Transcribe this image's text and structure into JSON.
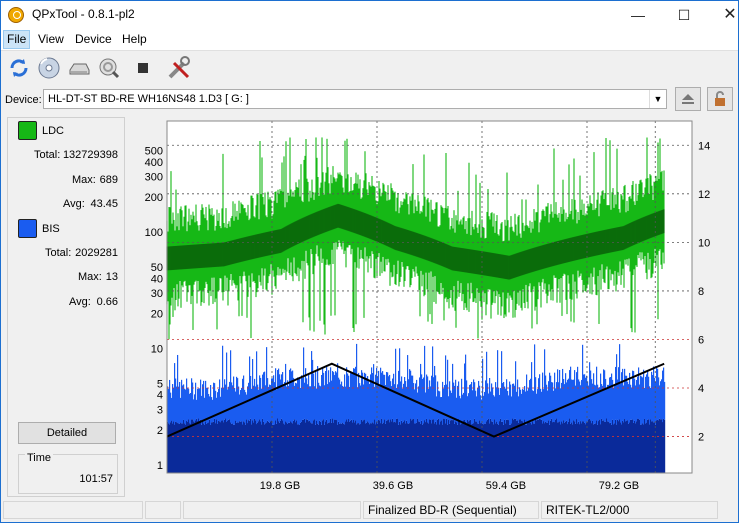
{
  "window": {
    "title": "QPxTool - 0.8.1-pl2"
  },
  "menu": {
    "items": [
      "File",
      "View",
      "Device",
      "Help"
    ]
  },
  "device": {
    "label": "Device:",
    "value": "HL-DT-ST BD-RE  WH16NS48  1.D3 [ G: ]"
  },
  "stats": {
    "ldc": {
      "label": "LDC",
      "color": "#16b816",
      "total_label": "Total:",
      "total": "132729398",
      "max_label": "Max:",
      "max": "689",
      "avg_label": "Avg:",
      "avg": "43.45"
    },
    "bis": {
      "label": "BIS",
      "color": "#1a5cf0",
      "total_label": "Total:",
      "total": "2029281",
      "max_label": "Max:",
      "max": "13",
      "avg_label": "Avg:",
      "avg": "0.66"
    },
    "detailed_button": "Detailed",
    "time_label": "Time",
    "time_value": "101:57"
  },
  "chart_data": {
    "type": "area",
    "x_ticks": [
      "19.8 GB",
      "39.6 GB",
      "59.4 GB",
      "79.2 GB"
    ],
    "x_tick_values": [
      19.8,
      39.6,
      59.4,
      79.2
    ],
    "x_max": 92,
    "y_left_scale": "log",
    "y_left_ticks": [
      "500",
      "400",
      "300",
      "200",
      "100",
      "50",
      "40",
      "30",
      "20",
      "10",
      "5",
      "4",
      "3",
      "2",
      "1"
    ],
    "y_right_ticks": [
      "14",
      "12",
      "10",
      "8",
      "6",
      "4",
      "2"
    ],
    "grid": true,
    "series": [
      {
        "name": "LDC",
        "color": "#16b816",
        "x": [
          0,
          10,
          20,
          30,
          40,
          50,
          60,
          70,
          80,
          92
        ],
        "values": [
          60,
          65,
          85,
          140,
          90,
          60,
          50,
          70,
          90,
          150
        ]
      },
      {
        "name": "BIS",
        "color": "#1a5cf0",
        "x": [
          0,
          10,
          20,
          30,
          40,
          50,
          60,
          70,
          80,
          92
        ],
        "values": [
          4,
          4,
          5,
          5,
          5,
          4,
          4,
          5,
          5,
          5
        ]
      },
      {
        "name": "Speed",
        "color": "#000000",
        "x": [
          0,
          30.5,
          60.5,
          92
        ],
        "values": [
          2.0,
          5.0,
          2.0,
          5.0
        ]
      }
    ]
  },
  "status": {
    "disc": "Finalized BD-R (Sequential)",
    "media": "RITEK-TL2/000"
  }
}
